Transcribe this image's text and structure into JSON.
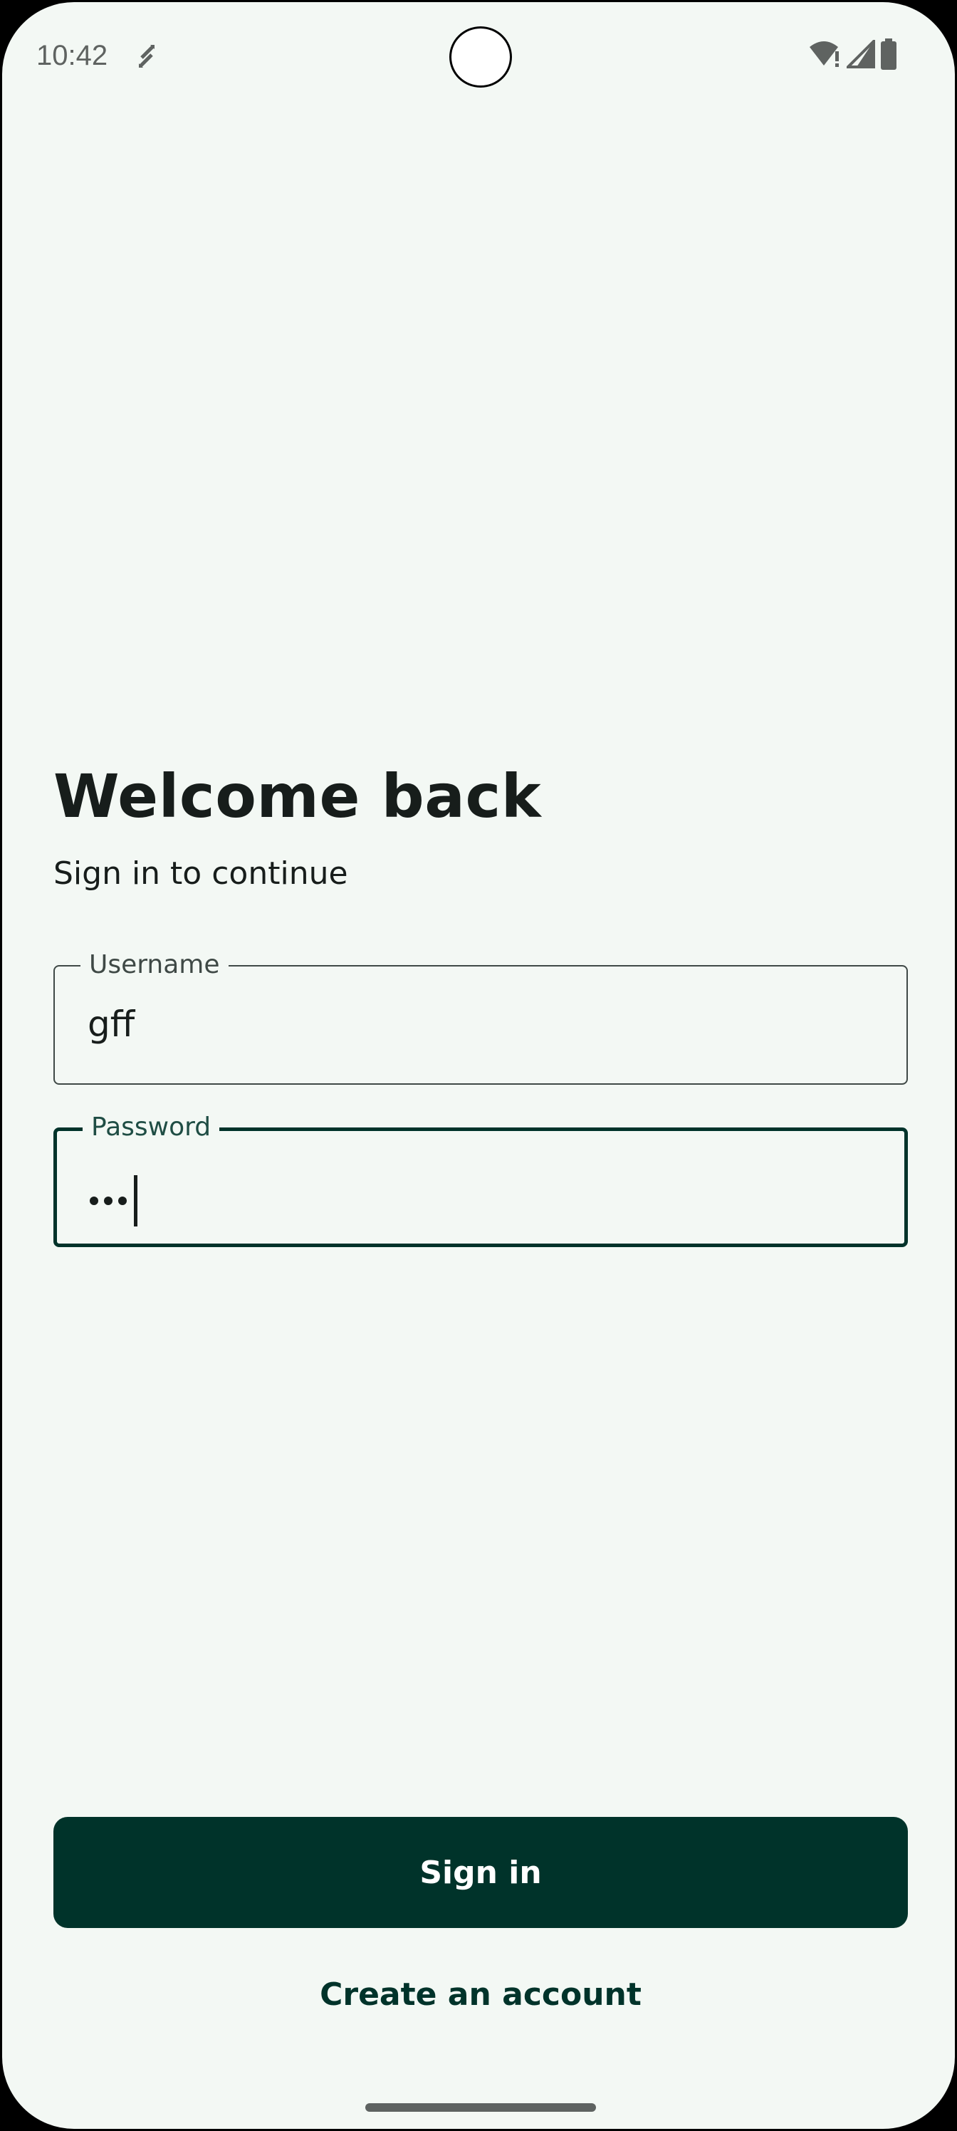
{
  "status_bar": {
    "time": "10:42",
    "icons": [
      "sync-arrows-icon",
      "wifi-alert-icon",
      "cellular-signal-icon",
      "battery-icon"
    ]
  },
  "login": {
    "title": "Welcome back",
    "subtitle": "Sign in to continue",
    "username_field": {
      "label": "Username",
      "value": "gff"
    },
    "password_field": {
      "label": "Password",
      "value": "•••",
      "masked_length": 3,
      "focused": true
    },
    "signin_label": "Sign in",
    "create_account_label": "Create an account"
  },
  "colors": {
    "background": "#f3f8f4",
    "primary": "#00332a",
    "text": "#171d1b",
    "outline": "#3f4946"
  }
}
